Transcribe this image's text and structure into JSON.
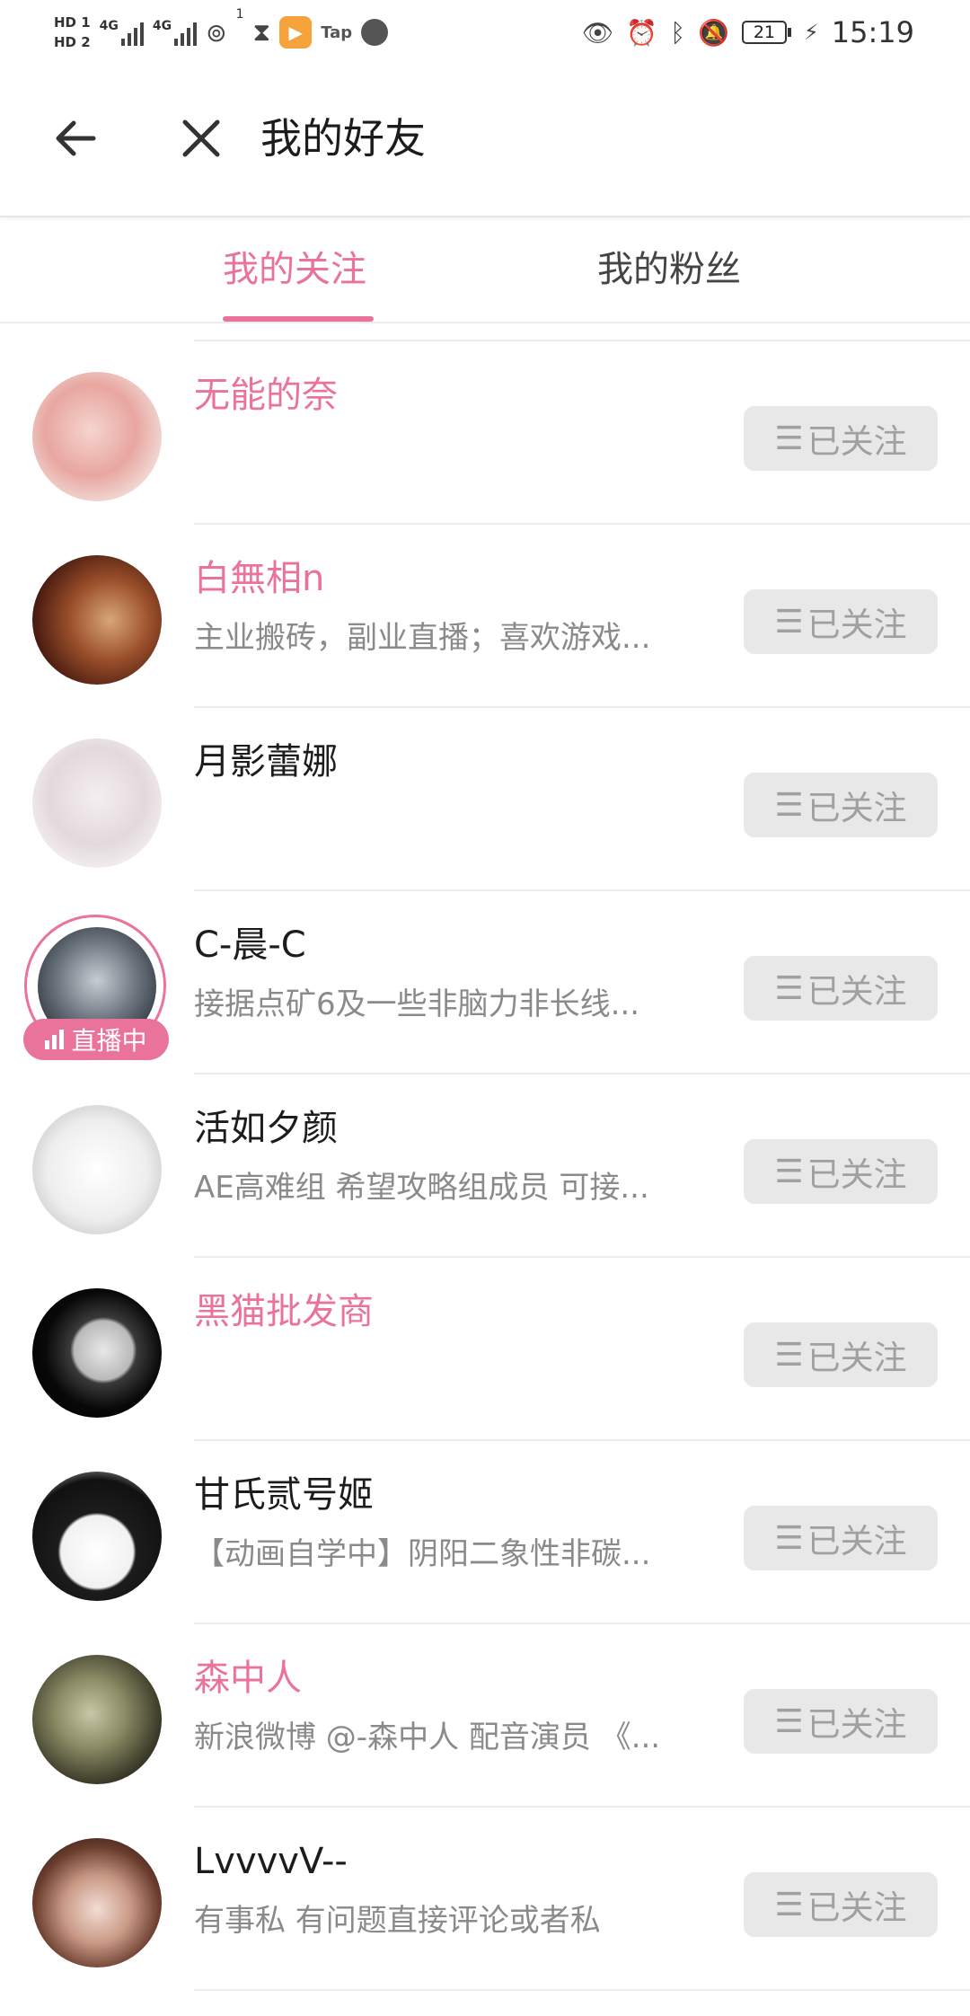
{
  "status_bar": {
    "hd1": "HD 1",
    "hd2": "HD 2",
    "net1": "4G",
    "net2": "4G",
    "hotspot_count": "1",
    "tap_label": "Tap",
    "battery": "21",
    "time": "15:19"
  },
  "header": {
    "title": "我的好友"
  },
  "tabs": [
    {
      "label": "我的关注",
      "active": true
    },
    {
      "label": "我的粉丝",
      "active": false
    }
  ],
  "colors": {
    "accent": "#e9739b",
    "button_bg": "#e8e8e8",
    "button_text": "#a0a0a0"
  },
  "follow_button_label": "已关注",
  "live_label": "直播中",
  "friends": [
    {
      "name": "无能的奈",
      "bio": "",
      "vip": true
    },
    {
      "name": "白無相n",
      "bio": "主业搬砖，副业直播；喜欢游戏...",
      "vip": true
    },
    {
      "name": "月影蕾娜",
      "bio": "",
      "vip": false
    },
    {
      "name": "C-晨-C",
      "bio": "接据点矿6及一些非脑力非长线...",
      "vip": false,
      "live": true
    },
    {
      "name": "活如夕颜",
      "bio": "AE高难组 希望攻略组成员 可接...",
      "vip": false
    },
    {
      "name": "黑猫批发商",
      "bio": "",
      "vip": true
    },
    {
      "name": "甘氏贰号姬",
      "bio": "【动画自学中】阴阳二象性非碳...",
      "vip": false
    },
    {
      "name": "森中人",
      "bio": "新浪微博 @-森中人 配音演员 《...",
      "vip": true
    },
    {
      "name": "LvvvvV--",
      "bio": "有事私 有问题直接评论或者私",
      "vip": false
    }
  ]
}
